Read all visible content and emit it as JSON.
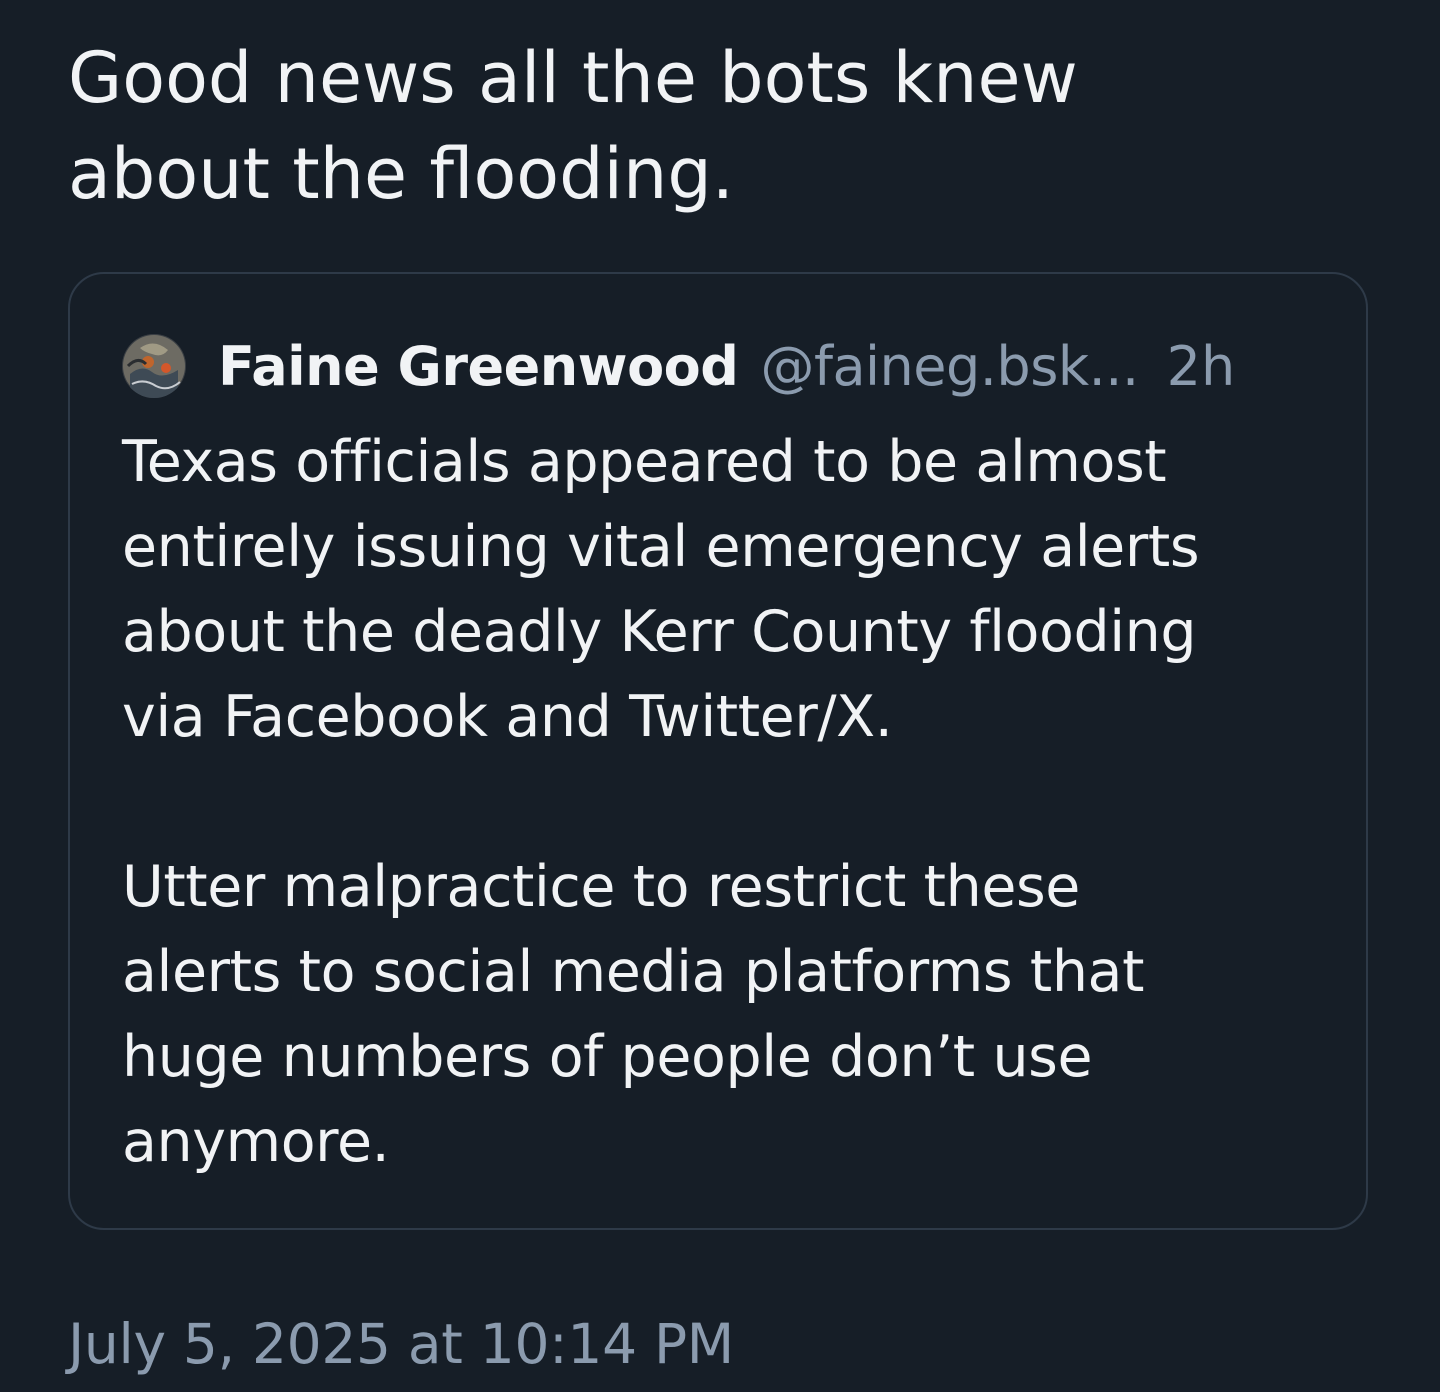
{
  "post": {
    "text_line1": "Good news all the bots knew",
    "text_line2": "about the flooding.",
    "timestamp": "July 5, 2025 at 10:14 PM"
  },
  "quoted_post": {
    "author_name": "Faine Greenwood",
    "author_handle": "@faineg.bsk...",
    "age": "2h",
    "avatar_icon": "profile-avatar",
    "paragraph1_lines": [
      "Texas officials appeared to be almost",
      "entirely issuing vital emergency alerts",
      "about the deadly Kerr County flooding",
      "via Facebook and Twitter/X."
    ],
    "paragraph2_lines": [
      "Utter malpractice to restrict these",
      "alerts to social media platforms that",
      "huge numbers of people don’t use",
      "anymore."
    ]
  },
  "colors": {
    "background": "#161e27",
    "primary_text": "#f1f3f5",
    "secondary_text": "#8b9bae",
    "card_border": "#2e3a48"
  }
}
